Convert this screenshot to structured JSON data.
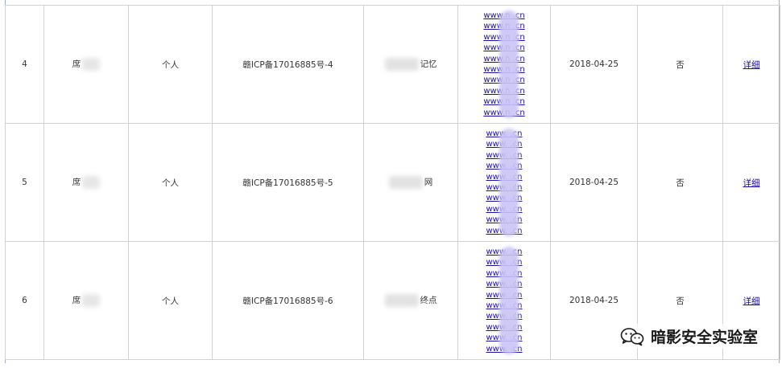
{
  "rows": [
    {
      "index": "4",
      "name_visible": "席",
      "type": "个人",
      "icp": "赣ICP备17016885号-4",
      "site_name_visible": "记忆",
      "domains": [
        "www.n .cn",
        "www.n .cn",
        "www.n .cn",
        "www.n .cn",
        "www.n .cn",
        "www.n .cn",
        "www.n .cn",
        "www.n .cn",
        "www.n .cn",
        "www.n .cn"
      ],
      "date": "2018-04-25",
      "flag": "否",
      "detail": "详细"
    },
    {
      "index": "5",
      "name_visible": "席",
      "type": "个人",
      "icp": "赣ICP备17016885号-5",
      "site_name_visible": "网",
      "domains": [
        "www. .cn",
        "www. .cn",
        "www. .cn",
        "www. .cn",
        "www. .cn",
        "www. .cn",
        "www. .cn",
        "www. .cn",
        "www. .cn",
        "www. .cn"
      ],
      "date": "2018-04-25",
      "flag": "否",
      "detail": "详细"
    },
    {
      "index": "6",
      "name_visible": "席",
      "type": "个人",
      "icp": "赣ICP备17016885号-6",
      "site_name_visible": "终点",
      "domains": [
        "www. .cn",
        "www. .cn",
        "www. .cn",
        "www. .cn",
        "www. .cn",
        "www. .cn",
        "www. .cn",
        "www. .cn",
        "www. .cn",
        "www. .cn"
      ],
      "date": "2018-04-25",
      "flag": "否",
      "detail": "详细"
    }
  ],
  "watermark": {
    "text": "暗影安全实验室",
    "icon": "wechat-icon"
  },
  "colors": {
    "link": "#1a0dab",
    "border": "#d2d2d2",
    "frame": "#9bb1cc",
    "mask": "#c9c4f4"
  }
}
